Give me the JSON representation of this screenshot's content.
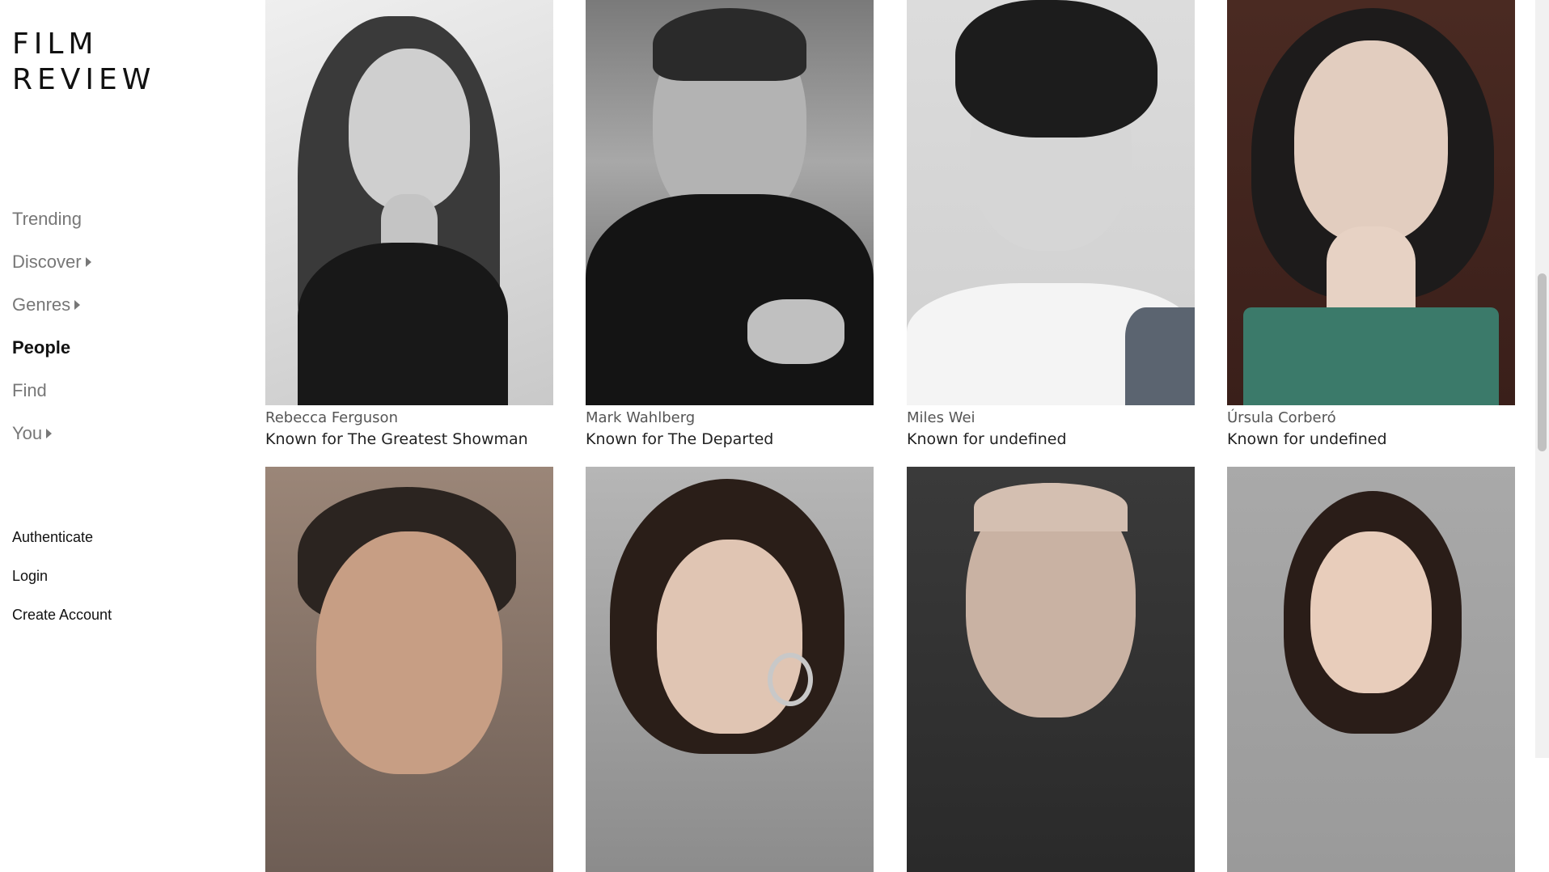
{
  "app": {
    "logo_line1": "FILM",
    "logo_line2": "REVIEW"
  },
  "nav": {
    "items": [
      {
        "label": "Trending",
        "has_caret": false,
        "active": false
      },
      {
        "label": "Discover",
        "has_caret": true,
        "active": false
      },
      {
        "label": "Genres",
        "has_caret": true,
        "active": false
      },
      {
        "label": "People",
        "has_caret": false,
        "active": true
      },
      {
        "label": "Find",
        "has_caret": false,
        "active": false
      },
      {
        "label": "You",
        "has_caret": true,
        "active": false
      }
    ]
  },
  "account": {
    "authenticate": "Authenticate",
    "login": "Login",
    "create_account": "Create Account"
  },
  "people": [
    {
      "name": "Rebecca Ferguson",
      "known_for": "Known for The Greatest Showman"
    },
    {
      "name": "Mark Wahlberg",
      "known_for": "Known for The Departed"
    },
    {
      "name": "Miles Wei",
      "known_for": "Known for undefined"
    },
    {
      "name": "Úrsula Corberó",
      "known_for": "Known for undefined"
    },
    {
      "name": "",
      "known_for": ""
    },
    {
      "name": "",
      "known_for": ""
    },
    {
      "name": "",
      "known_for": ""
    },
    {
      "name": "",
      "known_for": ""
    }
  ],
  "colors": {
    "active_nav": "#111111",
    "inactive_nav": "#777777"
  }
}
